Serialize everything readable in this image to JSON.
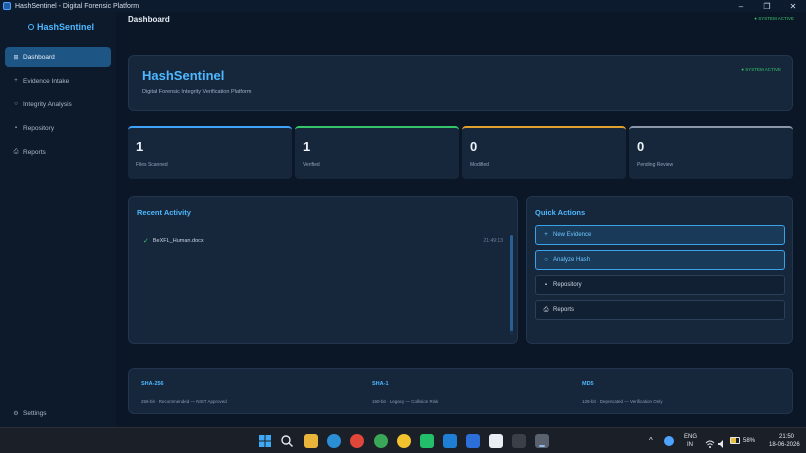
{
  "window": {
    "title": "HashSentinel - Digital Forensic Platform",
    "minimize": "–",
    "maximize": "❐",
    "close": "✕"
  },
  "sidebar": {
    "brand": "HashSentinel",
    "items": [
      {
        "label": "Dashboard",
        "icon": "⊞"
      },
      {
        "label": "Evidence Intake",
        "icon": "+"
      },
      {
        "label": "Integrity Analysis",
        "icon": "○"
      },
      {
        "label": "Repository",
        "icon": "▪"
      },
      {
        "label": "Reports",
        "icon": "⎙"
      }
    ],
    "settings": {
      "label": "Settings",
      "icon": "⚙"
    }
  },
  "header": {
    "title": "Dashboard",
    "status": "● SYSTEM ACTIVE"
  },
  "hero": {
    "title": "HashSentinel",
    "subtitle": "Digital Forensic Integrity Verification Platform",
    "status": "● SYSTEM ACTIVE"
  },
  "stats": [
    {
      "value": "1",
      "label": "Files Scanned",
      "color": "#3ea2f5"
    },
    {
      "value": "1",
      "label": "Verified",
      "color": "#36c46b"
    },
    {
      "value": "0",
      "label": "Modified",
      "color": "#e0a030"
    },
    {
      "value": "0",
      "label": "Pending Review",
      "color": "#8a97a8"
    }
  ],
  "recent_activity": {
    "title": "Recent Activity",
    "items": [
      {
        "name": "BeXFL_Human.docx",
        "time": "21:49:13",
        "icon": "✓"
      }
    ]
  },
  "quick_actions": {
    "title": "Quick Actions",
    "items": [
      {
        "label": "New Evidence",
        "icon": "+"
      },
      {
        "label": "Analyze Hash",
        "icon": "○"
      },
      {
        "label": "Repository",
        "icon": "▪"
      },
      {
        "label": "Reports",
        "icon": "⎙"
      }
    ]
  },
  "algorithms": [
    {
      "name": "SHA-256",
      "desc": "256-bit · Recommended — NIST Approved"
    },
    {
      "name": "SHA-1",
      "desc": "160-bit · Legacy — Collision Risk"
    },
    {
      "name": "MD5",
      "desc": "128-bit · Deprecated — Verification Only"
    }
  ],
  "taskbar": {
    "lang": "ENG",
    "region": "IN",
    "battery": "58%",
    "time": "21:50",
    "date": "18-06-2026",
    "tray_chevron": "^"
  },
  "colors": {
    "accent": "#4db8ff",
    "success": "#36c46b",
    "warning": "#e0a030",
    "bg": "#0b1626"
  }
}
